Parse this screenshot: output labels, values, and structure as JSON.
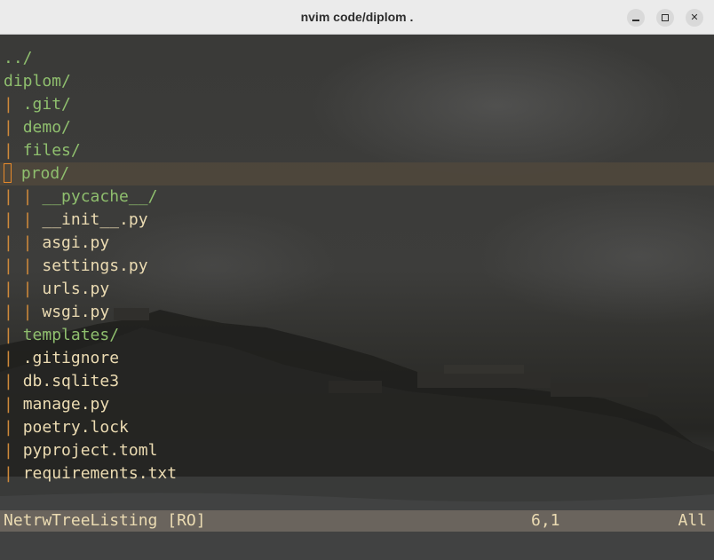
{
  "window": {
    "title": "nvim code/diplom ."
  },
  "tree": [
    {
      "prefix": "",
      "name": "../",
      "kind": "dir"
    },
    {
      "prefix": "",
      "name": "diplom/",
      "kind": "dir"
    },
    {
      "prefix": "| ",
      "name": ".git/",
      "kind": "dir"
    },
    {
      "prefix": "| ",
      "name": "demo/",
      "kind": "dir"
    },
    {
      "prefix": "| ",
      "name": "files/",
      "kind": "dir"
    },
    {
      "prefix": "| ",
      "name": "prod/",
      "kind": "dir"
    },
    {
      "prefix": "| | ",
      "name": "__pycache__/",
      "kind": "dir"
    },
    {
      "prefix": "| | ",
      "name": "__init__.py",
      "kind": "file"
    },
    {
      "prefix": "| | ",
      "name": "asgi.py",
      "kind": "file"
    },
    {
      "prefix": "| | ",
      "name": "settings.py",
      "kind": "file"
    },
    {
      "prefix": "| | ",
      "name": "urls.py",
      "kind": "file"
    },
    {
      "prefix": "| | ",
      "name": "wsgi.py",
      "kind": "file"
    },
    {
      "prefix": "| ",
      "name": "templates/",
      "kind": "dir"
    },
    {
      "prefix": "| ",
      "name": ".gitignore",
      "kind": "file"
    },
    {
      "prefix": "| ",
      "name": "db.sqlite3",
      "kind": "file"
    },
    {
      "prefix": "| ",
      "name": "manage.py",
      "kind": "file"
    },
    {
      "prefix": "| ",
      "name": "poetry.lock",
      "kind": "file"
    },
    {
      "prefix": "| ",
      "name": "pyproject.toml",
      "kind": "file"
    },
    {
      "prefix": "| ",
      "name": "requirements.txt",
      "kind": "file"
    }
  ],
  "cursor_line": 6,
  "statusline": {
    "filetype": "NetrwTreeListing [RO]",
    "position": "6,1",
    "scroll": "All"
  },
  "colors": {
    "directory": "#8fbf6e",
    "file": "#ebdbb2",
    "tree_bar": "#d08a3a",
    "cursor": "#e88a2a",
    "statusline_bg": "#6a645d"
  }
}
